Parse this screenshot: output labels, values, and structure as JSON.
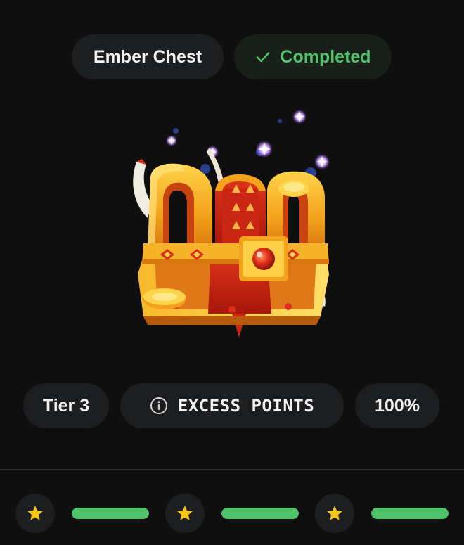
{
  "header": {
    "chest_name": "Ember Chest",
    "status_label": "Completed",
    "status_icon": "check-icon",
    "status_color": "#4fc36a"
  },
  "chest": {
    "image_icon": "treasure-chest-icon"
  },
  "details": {
    "tier_label": "Tier 3",
    "info_icon": "info-icon",
    "excess_label": "EXCESS POINTS",
    "percent_label": "100%"
  },
  "progress": {
    "colors": {
      "star": "#f5c518",
      "bar_fill": "#4fc36a"
    },
    "segments": [
      {
        "star_icon": "star-icon",
        "fill": 1.0
      },
      {
        "star_icon": "star-icon",
        "fill": 1.0
      },
      {
        "star_icon": "star-icon",
        "fill": 1.0
      }
    ]
  }
}
